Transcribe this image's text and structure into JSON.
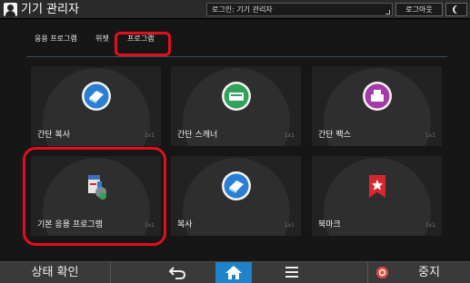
{
  "topbar": {
    "title": "기기 관리자",
    "login_status": "로그인: 기기 관리자",
    "logout_label": "로그아웃"
  },
  "tabs": [
    {
      "label": "응용 프로그램",
      "selected": false
    },
    {
      "label": "위젯",
      "selected": false
    },
    {
      "label": "프로그램",
      "selected": true
    }
  ],
  "tiles": [
    {
      "label": "간단 복사",
      "size": "1x1",
      "icon": "copy-book-icon",
      "color": "#2a7fd4"
    },
    {
      "label": "간단 스캐너",
      "size": "1x1",
      "icon": "scanner-icon",
      "color": "#2fa35c"
    },
    {
      "label": "간단 팩스",
      "size": "1x1",
      "icon": "fax-icon",
      "color": "#a63aa8"
    },
    {
      "label": "기본 응용 프로그램",
      "size": "1x1",
      "icon": "application-icon",
      "color": "#3b6ec0"
    },
    {
      "label": "복사",
      "size": "1x1",
      "icon": "copy-book-icon",
      "color": "#2a7fd4"
    },
    {
      "label": "북마크",
      "size": "1x1",
      "icon": "bookmark-icon",
      "color": "#d7262e"
    }
  ],
  "bottombar": {
    "status_label": "상태 확인",
    "stop_label": "중지"
  },
  "colors": {
    "highlight": "#e10e1e",
    "home_accent": "#1e83c9"
  }
}
